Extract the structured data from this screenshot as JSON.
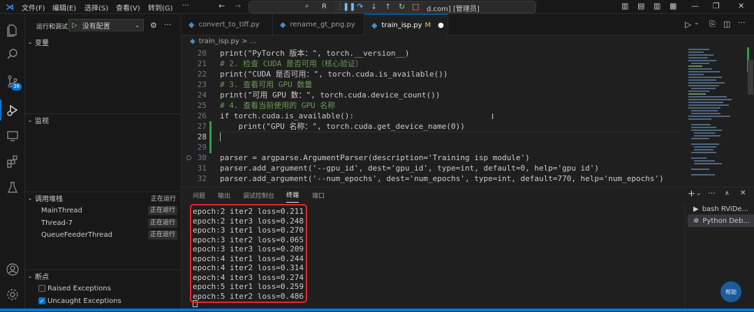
{
  "menubar": {
    "items": [
      "文件(F)",
      "编辑(E)",
      "选择(S)",
      "查看(V)",
      "转到(G)",
      "···"
    ],
    "command_center_left": "R",
    "command_center_right": "d.com] [管理员]"
  },
  "activity_bar": {
    "scm_badge": "38"
  },
  "sidebar": {
    "run_label": "运行和调试",
    "config_select": "没有配置",
    "variables_title": "变量",
    "watch_title": "监视",
    "callstack_title": "调用堆栈",
    "callstack_status": "正在运行",
    "threads": [
      {
        "name": "MainThread",
        "status": "正在运行"
      },
      {
        "name": "Thread-7",
        "status": "正在运行"
      },
      {
        "name": "QueueFeederThread",
        "status": "正在运行"
      }
    ],
    "breakpoints_title": "断点",
    "breakpoints": [
      {
        "label": "Raised Exceptions",
        "checked": false
      },
      {
        "label": "Uncaught Exceptions",
        "checked": true
      }
    ]
  },
  "tabs": [
    {
      "label": "convert_to_tiff.py",
      "active": false
    },
    {
      "label": "rename_gt_png.py",
      "active": false
    },
    {
      "label": "train_isp.py",
      "modified": "M",
      "active": true
    }
  ],
  "breadcrumb": "train_isp.py > ...",
  "editor": {
    "lines": [
      {
        "n": "20",
        "text": "print(\"PyTorch 版本：\", torch.__version__)"
      },
      {
        "n": "21",
        "text": "# 2. 检查 CUDA 是否可用（核心验证）"
      },
      {
        "n": "22",
        "text": "print(\"CUDA 是否可用：\", torch.cuda.is_available())"
      },
      {
        "n": "23",
        "text": "# 3. 查看可用 GPU 数量"
      },
      {
        "n": "24",
        "text": "print(\"可用 GPU 数：\", torch.cuda.device_count())"
      },
      {
        "n": "25",
        "text": "# 4. 查看当前使用的 GPU 名称"
      },
      {
        "n": "26",
        "text": "if torch.cuda.is_available():"
      },
      {
        "n": "27",
        "text": "    print(\"GPU 名称：\", torch.cuda.get_device_name(0))"
      },
      {
        "n": "28",
        "text": ""
      },
      {
        "n": "29",
        "text": ""
      },
      {
        "n": "30",
        "text": "parser = argparse.ArgumentParser(description='Training isp module')"
      },
      {
        "n": "31",
        "text": "parser.add_argument('--gpu_id', dest='gpu_id', type=int, default=0, help='gpu id')"
      },
      {
        "n": "32",
        "text": "parser.add_argument('--num_epochs', dest='num_epochs', type=int, default=770, help='num_epochs')"
      }
    ]
  },
  "panel": {
    "tabs": [
      "问题",
      "输出",
      "调试控制台",
      "终端",
      "端口"
    ],
    "active_tab": "终端",
    "terminal_lines": [
      "epoch:2 iter2 loss=0.211",
      "epoch:2 iter3 loss=0.248",
      "epoch:3 iter1 loss=0.270",
      "epoch:3 iter2 loss=0.065",
      "epoch:3 iter3 loss=0.209",
      "epoch:4 iter1 loss=0.244",
      "epoch:4 iter2 loss=0.314",
      "epoch:4 iter3 loss=0.274",
      "epoch:5 iter1 loss=0.259",
      "epoch:5 iter2 loss=0.486"
    ],
    "terminal_list": [
      {
        "label": "bash RViDe...",
        "selected": false
      },
      {
        "label": "Python Deb...",
        "selected": true
      }
    ]
  },
  "floating_button": "帮助"
}
